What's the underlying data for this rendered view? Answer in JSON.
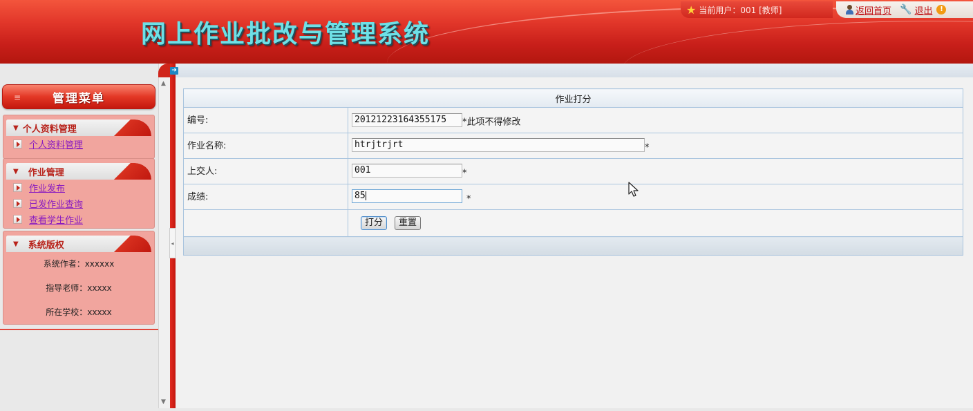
{
  "header": {
    "title": "网上作业批改与管理系统",
    "current_user_label": "当前用户：001 [教师]",
    "home_link": "返回首页",
    "logout_link": "退出"
  },
  "sidebar": {
    "menu_title": "管理菜单",
    "sections": [
      {
        "title": "个人资料管理",
        "items": [
          "个人资料管理"
        ]
      },
      {
        "title": "作业管理",
        "items": [
          "作业发布",
          "已发作业查询",
          "查看学生作业"
        ]
      },
      {
        "title": "系统版权",
        "info": [
          "系统作者：xxxxxx",
          "指导老师：xxxxx",
          "所在学校：xxxxx"
        ]
      }
    ]
  },
  "form": {
    "caption": "作业打分",
    "fields": {
      "id": {
        "label": "编号:",
        "value": "20121223164355175",
        "note": "*此项不得修改"
      },
      "name": {
        "label": "作业名称:",
        "value": "htrjtrjrt",
        "required": "*"
      },
      "submitter": {
        "label": "上交人:",
        "value": "001",
        "required": "*"
      },
      "score": {
        "label": "成绩:",
        "value": "85",
        "required": "*"
      }
    },
    "buttons": {
      "submit": "打分",
      "reset": "重置"
    }
  },
  "colors": {
    "header_red": "#d4291f",
    "title_cyan": "#6ee0e6",
    "panel_pink": "#f1a59e",
    "link_purple": "#8a1cc0",
    "table_border": "#a9c4de"
  },
  "icons": [
    "star-icon",
    "person-icon",
    "wrench-icon",
    "warning-icon",
    "menu-lines-icon",
    "triangle-down-icon",
    "bullet-arrow-icon",
    "arrow-right-icon",
    "mouse-cursor-icon"
  ]
}
